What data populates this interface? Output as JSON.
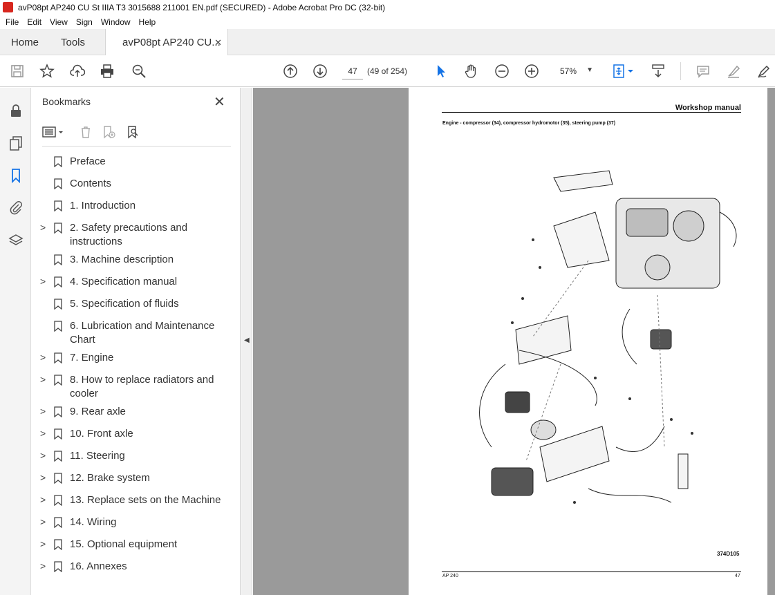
{
  "window": {
    "title": "avP08pt AP240 CU St IIIA T3 3015688 211001 EN.pdf (SECURED) - Adobe Acrobat Pro DC (32-bit)"
  },
  "menu": [
    "File",
    "Edit",
    "View",
    "Sign",
    "Window",
    "Help"
  ],
  "tabs": {
    "home": "Home",
    "tools": "Tools",
    "document": "avP08pt AP240 CU..."
  },
  "toolbar": {
    "page_number": "47",
    "page_count": "(49 of 254)",
    "zoom": "57%"
  },
  "bookmarks": {
    "title": "Bookmarks",
    "items": [
      {
        "label": "Preface",
        "expandable": false
      },
      {
        "label": "Contents",
        "expandable": false
      },
      {
        "label": "1. Introduction",
        "expandable": false
      },
      {
        "label": "2. Safety precautions and instructions",
        "expandable": true
      },
      {
        "label": "3. Machine description",
        "expandable": false
      },
      {
        "label": "4. Specification manual",
        "expandable": true
      },
      {
        "label": "5. Specification of fluids",
        "expandable": false
      },
      {
        "label": "6. Lubrication and Maintenance Chart",
        "expandable": false
      },
      {
        "label": "7. Engine",
        "expandable": true
      },
      {
        "label": "8. How to replace radiators and cooler",
        "expandable": true
      },
      {
        "label": "9. Rear axle",
        "expandable": true
      },
      {
        "label": "10. Front axle",
        "expandable": true
      },
      {
        "label": "11. Steering",
        "expandable": true
      },
      {
        "label": "12. Brake system",
        "expandable": true
      },
      {
        "label": "13. Replace sets on the Machine",
        "expandable": true
      },
      {
        "label": "14. Wiring",
        "expandable": true
      },
      {
        "label": "15. Optional equipment",
        "expandable": true
      },
      {
        "label": "16. Annexes",
        "expandable": true
      }
    ]
  },
  "page": {
    "header": "Workshop manual",
    "subtitle": "Engine - compressor (34), compressor hydromotor (35), steering pump (37)",
    "figure_code": "374D105",
    "footer_left": "AP 240",
    "footer_right": "47"
  },
  "colors": {
    "accent": "#1473e6",
    "rail_bg": "#f4f4f4",
    "doc_bg": "#9a9a9a"
  }
}
